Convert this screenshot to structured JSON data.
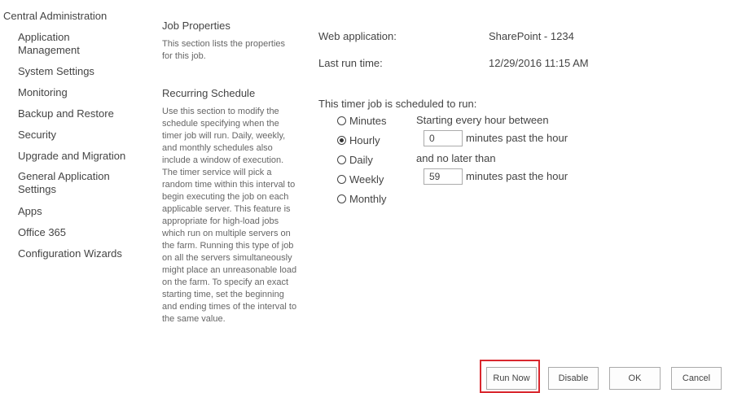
{
  "nav": {
    "root": "Central Administration",
    "items": [
      {
        "label": "Application\nManagement"
      },
      {
        "label": "System Settings"
      },
      {
        "label": "Monitoring"
      },
      {
        "label": "Backup and Restore"
      },
      {
        "label": "Security"
      },
      {
        "label": "Upgrade and Migration"
      },
      {
        "label": "General Application\nSettings"
      },
      {
        "label": "Apps"
      },
      {
        "label": "Office 365"
      },
      {
        "label": "Configuration Wizards"
      }
    ]
  },
  "job_properties": {
    "title": "Job Properties",
    "description": "This section lists the properties for this job.",
    "web_app_label": "Web application:",
    "web_app_value": "SharePoint - 1234",
    "last_run_label": "Last run time:",
    "last_run_value": "12/29/2016 11:15 AM"
  },
  "recurring": {
    "title": "Recurring Schedule",
    "description": "Use this section to modify the schedule specifying when the timer job will run. Daily, weekly, and monthly schedules also include a window of execution. The timer service will pick a random time within this interval to begin executing the job on each applicable server. This feature is appropriate for high-load jobs which run on multiple servers on the farm. Running this type of job on all the servers simultaneously might place an unreasonable load on the farm. To specify an exact starting time, set the beginning and ending times of the interval to the same value.",
    "schedule_label": "This timer job is scheduled to run:",
    "options": [
      {
        "label": "Minutes",
        "checked": false
      },
      {
        "label": "Hourly",
        "checked": true
      },
      {
        "label": "Daily",
        "checked": false
      },
      {
        "label": "Weekly",
        "checked": false
      },
      {
        "label": "Monthly",
        "checked": false
      }
    ],
    "starting_label": "Starting every hour between",
    "start_value": "0",
    "start_suffix": "minutes past the hour",
    "no_later_label": "and no later than",
    "end_value": "59",
    "end_suffix": "minutes past the hour"
  },
  "buttons": {
    "run_now": "Run Now",
    "disable": "Disable",
    "ok": "OK",
    "cancel": "Cancel"
  },
  "colors": {
    "highlight": "#d9272e"
  }
}
